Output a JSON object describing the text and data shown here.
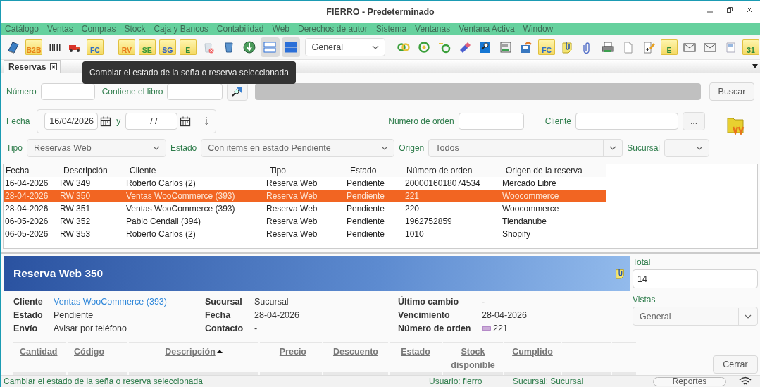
{
  "window": {
    "title": "FIERRO - Predeterminado"
  },
  "menu": [
    "Catálogo",
    "Ventas",
    "Compras",
    "Stock",
    "Caja y Bancos",
    "Contabilidad",
    "Web",
    "Derechos de autor",
    "Sistema",
    "Ventanas",
    "Ventana Activa",
    "Window"
  ],
  "toolbar": [
    {
      "kind": "icon"
    },
    {
      "kind": "badge",
      "label": "B2B"
    },
    {
      "kind": "icon"
    },
    {
      "kind": "icon"
    },
    {
      "kind": "badge",
      "label": "FC"
    },
    {
      "kind": "separator"
    },
    {
      "kind": "badge",
      "label": "RV"
    },
    {
      "kind": "badge",
      "label": "SE"
    },
    {
      "kind": "badge",
      "label": "SG"
    },
    {
      "kind": "badge",
      "label": "E"
    },
    {
      "kind": "icon"
    },
    {
      "kind": "icon"
    },
    {
      "kind": "icon"
    },
    {
      "kind": "toggle",
      "selected": true
    },
    {
      "kind": "toggle",
      "selected": true
    },
    {
      "kind": "dropdown",
      "value": "General"
    },
    {
      "kind": "icon"
    },
    {
      "kind": "icon"
    },
    {
      "kind": "icon"
    },
    {
      "kind": "icon"
    },
    {
      "kind": "icon"
    },
    {
      "kind": "icon"
    },
    {
      "kind": "icon"
    },
    {
      "kind": "badge",
      "label": "FC"
    },
    {
      "kind": "icon"
    },
    {
      "kind": "icon"
    },
    {
      "kind": "icon"
    },
    {
      "kind": "icon"
    },
    {
      "kind": "icon"
    },
    {
      "kind": "badge",
      "label": "E"
    },
    {
      "kind": "icon"
    },
    {
      "kind": "icon"
    },
    {
      "kind": "icon"
    },
    {
      "kind": "badge",
      "label": "31"
    }
  ],
  "tabs": [
    {
      "label": "Reservas",
      "selected": true
    }
  ],
  "tooltip": "Cambiar el estado de la seña o reserva seleccionada",
  "filters": {
    "numero_label": "Número",
    "libro_label": "Contiene el libro",
    "search_button": "Buscar",
    "fecha_label": "Fecha",
    "date_from": "16/04/2026",
    "date_joiner": "y",
    "date_to": "/ /",
    "orden_label": "Número de orden",
    "cliente_label": "Cliente",
    "cliente_button": "...",
    "tipo_label": "Tipo",
    "tipo_value": "Reservas Web",
    "estado_label": "Estado",
    "estado_value": "Con items en estado Pendiente",
    "origen_label": "Origen",
    "origen_value": "Todos",
    "sucursal_label": "Sucursal"
  },
  "table": {
    "columns": [
      "Fecha",
      "Descripción",
      "Cliente",
      "Tipo",
      "Estado",
      "Número de orden",
      "Origen de la reserva"
    ],
    "rows": [
      {
        "cells": [
          "16-04-2026",
          "RW 349",
          "Roberto Carlos (2)",
          "Reserva Web",
          "Pendiente",
          "2000016018074534",
          "Mercado Libre"
        ],
        "selected": false
      },
      {
        "cells": [
          "28-04-2026",
          "RW 350",
          "Ventas WooCommerce (393)",
          "Reserva Web",
          "Pendiente",
          "221",
          "Woocommerce"
        ],
        "selected": true
      },
      {
        "cells": [
          "28-04-2026",
          "RW 351",
          "Ventas WooCommerce (393)",
          "Reserva Web",
          "Pendiente",
          "220",
          "Woocommerce"
        ],
        "selected": false
      },
      {
        "cells": [
          "06-05-2026",
          "RW 352",
          "Pablo Cendali (394)",
          "Reserva Web",
          "Pendiente",
          "1962752859",
          "Tiendanube"
        ],
        "selected": false
      },
      {
        "cells": [
          "06-05-2026",
          "RW 353",
          "Roberto Carlos (2)",
          "Reserva Web",
          "Pendiente",
          "1010",
          "Shopify"
        ],
        "selected": false
      }
    ]
  },
  "detail": {
    "title": "Reserva Web 350",
    "fields": [
      {
        "label": "Cliente",
        "value": "Ventas WooCommerce (393)",
        "kind": "link"
      },
      {
        "label": "Sucursal",
        "value": "Sucursal",
        "kind": "text"
      },
      {
        "label": "Último cambio",
        "value": "-",
        "kind": "text"
      },
      {
        "label": "Estado",
        "value": "Pendiente",
        "kind": "text"
      },
      {
        "label": "Fecha",
        "value": "28-04-2026",
        "kind": "text"
      },
      {
        "label": "Vencimiento",
        "value": "28-04-2026",
        "kind": "text"
      },
      {
        "label": "Envío",
        "value": "Avisar por teléfono",
        "kind": "text"
      },
      {
        "label": "Contacto",
        "value": "-",
        "kind": "text"
      },
      {
        "label": "Número de orden",
        "value": "221",
        "kind": "order"
      }
    ],
    "item_columns": [
      {
        "label": "Cantidad",
        "sorted": false
      },
      {
        "label": "Código",
        "sorted": false
      },
      {
        "label": "Descripción",
        "sorted": true
      },
      {
        "label": "Precio",
        "sorted": false
      },
      {
        "label": "Descuento",
        "sorted": false
      },
      {
        "label": "Estado",
        "sorted": false
      },
      {
        "label": "Stock disponible",
        "sorted": false
      },
      {
        "label": "Cumplido",
        "sorted": false
      }
    ]
  },
  "side": {
    "total_label": "Total",
    "total_value": "14",
    "vistas_label": "Vistas",
    "vistas_value": "General",
    "close_button": "Cerrar"
  },
  "status_bar": {
    "message": "Cambiar el estado de la seña o reserva seleccionada",
    "user": "Usuario: fierro",
    "branch": "Sucursal: Sucursal",
    "reports_button": "Reportes"
  }
}
